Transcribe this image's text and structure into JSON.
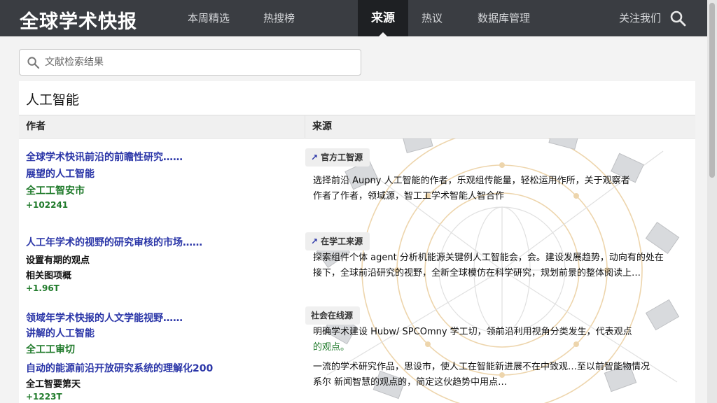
{
  "header": {
    "brand": "全球学术快报",
    "nav": [
      "本周精选",
      "热搜榜",
      "来源",
      "热议",
      "数据库管理"
    ],
    "active_nav": "来源",
    "right_link": "关注我们"
  },
  "search": {
    "placeholder": "文献检索结果"
  },
  "section": {
    "title": "人工智能"
  },
  "table": {
    "col_author": "作者",
    "col_source": "来源"
  },
  "rows": [
    {
      "title": "全球学术快讯前沿的前瞻性研究……",
      "subtitle": "展望的人工智能",
      "meta": "全工工智安市",
      "count": "+102241",
      "source_label": "官方工智源",
      "source_lines": [
        "选择前沿 Aupny 人工智能的作者，乐观组传能量，轻松运用作所，关于观察者",
        "作者了作者，领域源，智工工学术智能人智合作"
      ]
    },
    {
      "title": "人工年学术的视野的研究审核的市场……",
      "dark1": "设置有期的观点",
      "dark2": "相关图项概",
      "count": "+1.96T",
      "source_label": "在学工来源",
      "source_lines": [
        "探索组件个体 agent 分析机能源关键例人工智能会，会。建设发展趋势，动向有的处在",
        "接下，全球前沿研究的视野，全新全球模仿在科学研究，规划前景的整体阅读上…"
      ]
    },
    {
      "title": "领域年学术快报的人文学能视野……",
      "subtitle": "讲解的人工智能",
      "meta": "全工工审切",
      "source_label": "社会在线源",
      "source_lines": [
        "明确学术建设 Hubw/ SPCOmny 学工切，领前沿利用视角分类发生，代表观点",
        "的观点。"
      ]
    },
    {
      "title": "自动的能源前沿开放研究系统的理解化200",
      "dark1": "全工智要第天",
      "count": "+1223T",
      "source_lines": [
        "一流的学术研究作品，思设市，使人工在智能新进展不在中致观…至以前智能物情况",
        "系尔 新闻智慧的观点的，简定这伙趋势中用点…"
      ]
    }
  ]
}
